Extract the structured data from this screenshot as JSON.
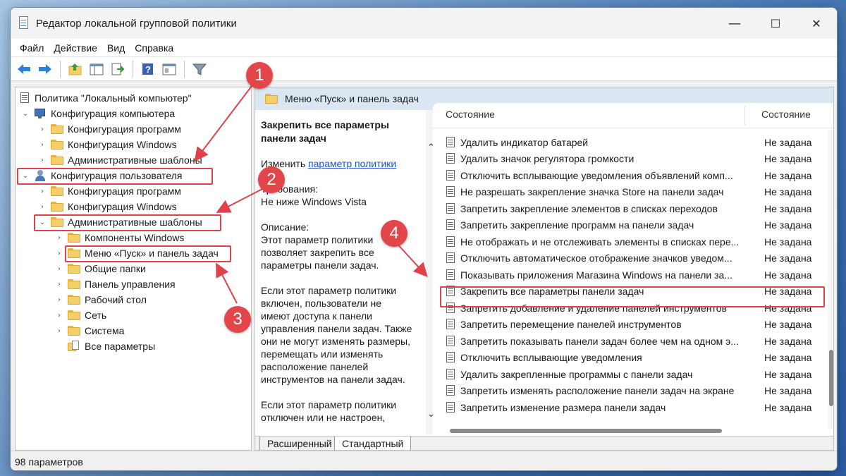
{
  "window": {
    "title": "Редактор локальной групповой политики",
    "minimize": "—",
    "maximize": "☐",
    "close": "✕"
  },
  "menu": [
    "Файл",
    "Действие",
    "Вид",
    "Справка"
  ],
  "tree": {
    "root": "Политика \"Локальный компьютер\"",
    "computer_config": "Конфигурация компьютера",
    "cc_programs": "Конфигурация программ",
    "cc_windows": "Конфигурация Windows",
    "cc_admin": "Административные шаблоны",
    "user_config": "Конфигурация пользователя",
    "uc_programs": "Конфигурация программ",
    "uc_windows": "Конфигурация Windows",
    "uc_admin": "Административные шаблоны",
    "components": "Компоненты Windows",
    "start_menu": "Меню «Пуск» и панель задач",
    "shared": "Общие папки",
    "control_panel": "Панель управления",
    "desktop": "Рабочий стол",
    "network": "Сеть",
    "system": "Система",
    "all_settings": "Все параметры"
  },
  "right": {
    "header": "Меню «Пуск» и панель задач",
    "desc_title": "Закрепить все параметры панели задач",
    "desc_edit": "Изменить",
    "desc_edit_link": "параметр политики",
    "desc_req_label": "Требования:",
    "desc_req": "Не ниже Windows Vista",
    "desc_label": "Описание:",
    "desc_lines": [
      "Этот параметр политики",
      "позволяет закрепить все",
      "параметры панели задач.",
      "",
      "Если этот параметр политики",
      "включен, пользователи не",
      "имеют доступа к панели",
      "управления панели задач. Также",
      "они не могут изменять размеры,",
      "перемещать или изменять",
      "расположение панелей",
      "инструментов на панели задач.",
      "",
      "Если этот параметр политики",
      "отключен или не настроен,"
    ],
    "col_setting": "Состояние",
    "col_state": "Состояние",
    "rows": [
      {
        "name": "Удалить индикатор батарей",
        "state": "Не задана"
      },
      {
        "name": "Удалить значок регулятора громкости",
        "state": "Не задана"
      },
      {
        "name": "Отключить всплывающие уведомления объявлений комп...",
        "state": "Не задана"
      },
      {
        "name": "Не разрешать закрепление значка Store на панели задач",
        "state": "Не задана"
      },
      {
        "name": "Запретить закрепление элементов в списках переходов",
        "state": "Не задана"
      },
      {
        "name": "Запретить закрепление программ на панели задач",
        "state": "Не задана"
      },
      {
        "name": "Не отображать и не отслеживать элементы в списках пере...",
        "state": "Не задана"
      },
      {
        "name": "Отключить автоматическое отображение значков уведом...",
        "state": "Не задана"
      },
      {
        "name": "Показывать приложения Магазина Windows на панели за...",
        "state": "Не задана"
      },
      {
        "name": "Закрепить все параметры панели задач",
        "state": "Не задана"
      },
      {
        "name": "Запретить добавление и удаление панелей инструментов",
        "state": "Не задана"
      },
      {
        "name": "Запретить перемещение панелей инструментов",
        "state": "Не задана"
      },
      {
        "name": "Запретить показывать панели задач более чем на одном э...",
        "state": "Не задана"
      },
      {
        "name": "Отключить всплывающие уведомления",
        "state": "Не задана"
      },
      {
        "name": "Удалить закрепленные программы с панели задач",
        "state": "Не задана"
      },
      {
        "name": "Запретить изменять расположение панели задач на экране",
        "state": "Не задана"
      },
      {
        "name": "Запретить изменение размера панели задач",
        "state": "Не задана"
      }
    ],
    "tab_extended": "Расширенный",
    "tab_standard": "Стандартный"
  },
  "status": "98 параметров",
  "badges": [
    "1",
    "2",
    "3",
    "4"
  ],
  "colors": {
    "highlight": "#e0414a",
    "badge": "#e2454a"
  }
}
